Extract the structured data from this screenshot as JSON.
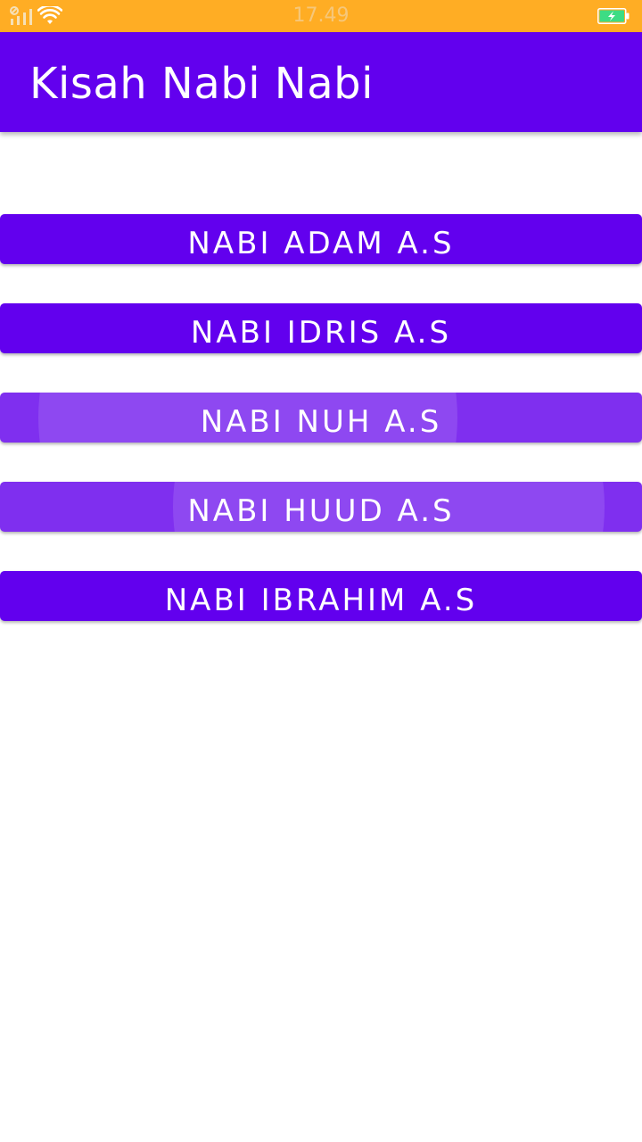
{
  "status_bar": {
    "time": "17.49",
    "background": "#FFAD24",
    "icons": [
      "signal-icon",
      "wifi-icon",
      "battery-charging-icon"
    ]
  },
  "app_bar": {
    "title": "Kisah Nabi Nabi",
    "background": "#6200EE"
  },
  "buttons": [
    {
      "label": "NABI ADAM A.S"
    },
    {
      "label": "NABI IDRIS A.S"
    },
    {
      "label": "NABI NUH A.S"
    },
    {
      "label": "NABI HUUD A.S"
    },
    {
      "label": "NABI IBRAHIM A.S"
    }
  ],
  "colors": {
    "primary": "#6200EE",
    "pressed": "#7F2FEF",
    "status": "#FFAD24",
    "battery_fill": "#3DDC84"
  }
}
